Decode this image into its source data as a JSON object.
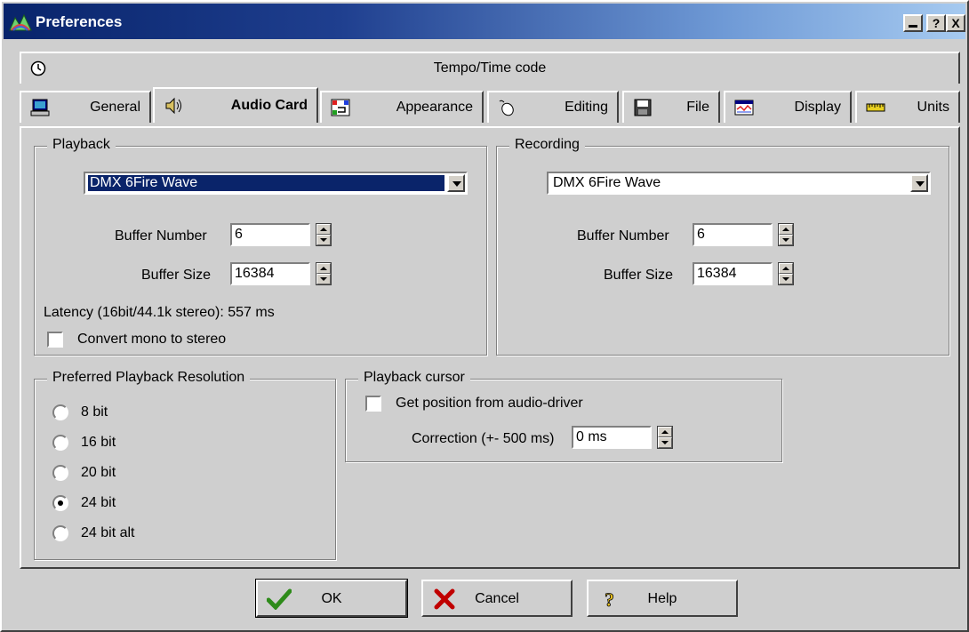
{
  "window": {
    "title": "Preferences",
    "min_label": "",
    "help_label": "?",
    "close_label": "X"
  },
  "tabs_row1": [
    {
      "label": "Tempo/Time code",
      "icon": "clock-icon"
    }
  ],
  "tabs_row2": [
    {
      "label": "General",
      "icon": "computer-icon"
    },
    {
      "label": "Audio Card",
      "icon": "speaker-icon",
      "active": true
    },
    {
      "label": "Appearance",
      "icon": "palette-icon"
    },
    {
      "label": "Editing",
      "icon": "mouse-icon"
    },
    {
      "label": "File",
      "icon": "floppy-disk-icon"
    },
    {
      "label": "Display",
      "icon": "display-icon"
    },
    {
      "label": "Units",
      "icon": "ruler-icon"
    }
  ],
  "playback": {
    "title": "Playback",
    "device": "DMX 6Fire Wave",
    "buffer_number_label": "Buffer Number",
    "buffer_number": "6",
    "buffer_size_label": "Buffer Size",
    "buffer_size": "16384",
    "latency": "Latency (16bit/44.1k stereo): 557 ms",
    "convert_mono_label": "Convert mono to stereo",
    "convert_mono_checked": false
  },
  "recording": {
    "title": "Recording",
    "device": "DMX 6Fire Wave",
    "buffer_number_label": "Buffer Number",
    "buffer_number": "6",
    "buffer_size_label": "Buffer Size",
    "buffer_size": "16384"
  },
  "resolution": {
    "title": "Preferred Playback Resolution",
    "options": [
      {
        "label": "8 bit",
        "selected": false
      },
      {
        "label": "16 bit",
        "selected": false
      },
      {
        "label": "20 bit",
        "selected": false
      },
      {
        "label": "24 bit",
        "selected": true
      },
      {
        "label": "24 bit alt",
        "selected": false
      }
    ]
  },
  "cursor": {
    "title": "Playback cursor",
    "get_position_label": "Get position from audio-driver",
    "get_position_checked": false,
    "correction_label": "Correction (+- 500 ms)",
    "correction_value": "0 ms"
  },
  "buttons": {
    "ok": "OK",
    "cancel": "Cancel",
    "help": "Help"
  },
  "colors": {
    "selection": "#0a246a",
    "ok_check": "#2e8b1a",
    "cancel_x": "#c00000"
  }
}
